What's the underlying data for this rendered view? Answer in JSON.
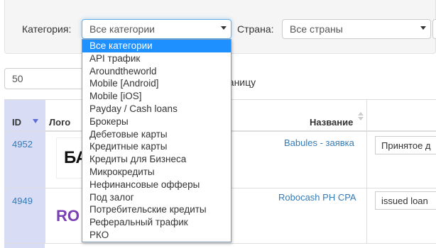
{
  "filters": {
    "category_label": "Категория:",
    "category_value": "Все категории",
    "country_label": "Страна:",
    "country_value": "Все страны"
  },
  "pagination": {
    "per_page_value": "50",
    "per_page_label_tail": "раницу"
  },
  "table": {
    "headers": {
      "id": "ID",
      "logo": "Лого",
      "name": "Название"
    },
    "rows": [
      {
        "id": "4952",
        "logo_text": "БА",
        "name": "Babules - заявка",
        "goal": "Принятое д"
      },
      {
        "id": "4949",
        "logo_text": "RO",
        "name": "Robocash PH CPA",
        "goal": "issued loan"
      }
    ]
  },
  "category_dropdown": {
    "options": [
      "Все категории",
      "API трафик",
      "Aroundtheworld",
      "Mobile [Android]",
      "Mobile [iOS]",
      "Payday / Cash loans",
      "Брокеры",
      "Дебетовые карты",
      "Кредитные карты",
      "Кредиты для Бизнеса",
      "Микрокредиты",
      "Нефинансовые офферы",
      "Под залог",
      "Потребительские кредиты",
      "Реферальный трафик",
      "РКО"
    ],
    "selected_index": 0
  },
  "colors": {
    "accent_link": "#337ab7",
    "selected_option": "#1e90ff",
    "id_cell_bg": "#d9dcf5",
    "sort_arrow": "#5b6dd6"
  }
}
